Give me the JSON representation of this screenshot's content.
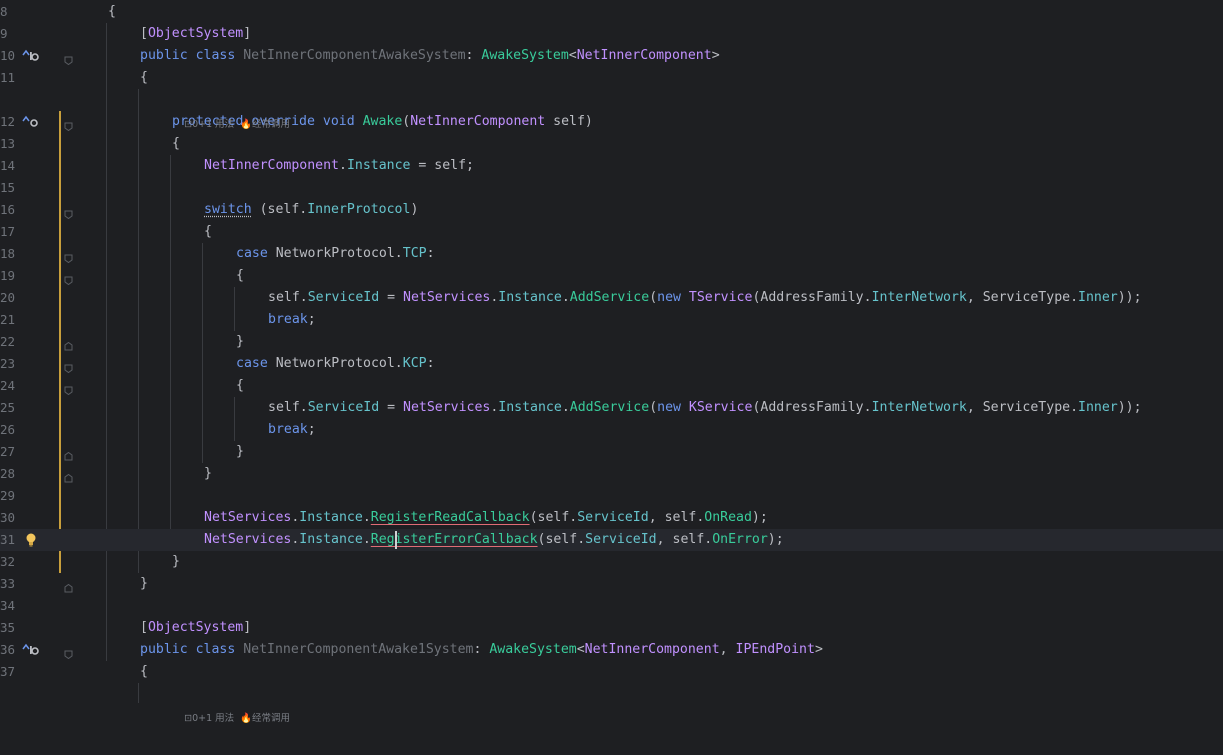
{
  "editor": {
    "colors": {
      "background": "#1e1f22",
      "keyword": "#6c95eb",
      "type": "#c191ff",
      "method": "#39cc9b",
      "field": "#66c3cc",
      "line_number": "#6f737a",
      "vcs_modified": "#c89f3c"
    },
    "hints": [
      {
        "line": 12,
        "usages": "0+1 用法",
        "frequent": "经常调用"
      },
      {
        "line": 38,
        "usages": "0+1 用法",
        "frequent": "经常调用"
      }
    ],
    "lines": [
      {
        "n": "8",
        "indent": 0,
        "fold": false,
        "gutter_icon": "",
        "tokens": [
          {
            "t": "{",
            "c": "pun"
          }
        ]
      },
      {
        "n": "9",
        "indent": 1,
        "fold": false,
        "gutter_icon": "",
        "tokens": [
          {
            "t": "[",
            "c": "pun"
          },
          {
            "t": "ObjectSystem",
            "c": "attr"
          },
          {
            "t": "]",
            "c": "pun"
          }
        ]
      },
      {
        "n": "10",
        "indent": 1,
        "fold": true,
        "gutter_icon": "implemented-icon",
        "tokens": [
          {
            "t": "public ",
            "c": "kw"
          },
          {
            "t": "class ",
            "c": "kw"
          },
          {
            "t": "NetInnerComponentAwakeSystem",
            "c": "tyd"
          },
          {
            "t": ": ",
            "c": "pun"
          },
          {
            "t": "AwakeSystem",
            "c": "mt"
          },
          {
            "t": "<",
            "c": "pun"
          },
          {
            "t": "NetInnerComponent",
            "c": "ty"
          },
          {
            "t": ">",
            "c": "pun"
          }
        ]
      },
      {
        "n": "11",
        "indent": 1,
        "fold": false,
        "gutter_icon": "",
        "tokens": [
          {
            "t": "{",
            "c": "pun"
          }
        ]
      },
      {
        "n": "12",
        "indent": 2,
        "fold": true,
        "gutter_icon": "override-icon",
        "tokens": [
          {
            "t": "protected ",
            "c": "kw"
          },
          {
            "t": "override ",
            "c": "kw"
          },
          {
            "t": "void ",
            "c": "kw"
          },
          {
            "t": "Awake",
            "c": "mt"
          },
          {
            "t": "(",
            "c": "pun"
          },
          {
            "t": "NetInnerComponent",
            "c": "ty"
          },
          {
            "t": " self)",
            "c": "tx"
          }
        ]
      },
      {
        "n": "13",
        "indent": 2,
        "fold": false,
        "gutter_icon": "",
        "tokens": [
          {
            "t": "{",
            "c": "pun"
          }
        ]
      },
      {
        "n": "14",
        "indent": 3,
        "fold": false,
        "gutter_icon": "",
        "tokens": [
          {
            "t": "NetInnerComponent",
            "c": "ty"
          },
          {
            "t": ".",
            "c": "pun"
          },
          {
            "t": "Instance",
            "c": "fd"
          },
          {
            "t": " = self;",
            "c": "tx"
          }
        ]
      },
      {
        "n": "15",
        "indent": 0,
        "fold": false,
        "gutter_icon": "",
        "tokens": []
      },
      {
        "n": "16",
        "indent": 3,
        "fold": true,
        "gutter_icon": "",
        "tokens": [
          {
            "t": "switch",
            "c": "kw ul-dot"
          },
          {
            "t": " (self.",
            "c": "tx"
          },
          {
            "t": "InnerProtocol",
            "c": "fd"
          },
          {
            "t": ")",
            "c": "pun"
          }
        ]
      },
      {
        "n": "17",
        "indent": 3,
        "fold": false,
        "gutter_icon": "",
        "tokens": [
          {
            "t": "{",
            "c": "pun"
          }
        ]
      },
      {
        "n": "18",
        "indent": 4,
        "fold": true,
        "gutter_icon": "",
        "tokens": [
          {
            "t": "case ",
            "c": "kw"
          },
          {
            "t": "NetworkProtocol",
            "c": "tx"
          },
          {
            "t": ".",
            "c": "pun"
          },
          {
            "t": "TCP",
            "c": "fd"
          },
          {
            "t": ":",
            "c": "pun"
          }
        ]
      },
      {
        "n": "19",
        "indent": 4,
        "fold": true,
        "gutter_icon": "",
        "tokens": [
          {
            "t": "{",
            "c": "pun"
          }
        ]
      },
      {
        "n": "20",
        "indent": 5,
        "fold": false,
        "gutter_icon": "",
        "tokens": [
          {
            "t": "self.",
            "c": "tx"
          },
          {
            "t": "ServiceId",
            "c": "fd"
          },
          {
            "t": " = ",
            "c": "tx"
          },
          {
            "t": "NetServices",
            "c": "ty"
          },
          {
            "t": ".",
            "c": "pun"
          },
          {
            "t": "Instance",
            "c": "fd"
          },
          {
            "t": ".",
            "c": "pun"
          },
          {
            "t": "AddService",
            "c": "mt"
          },
          {
            "t": "(",
            "c": "pun"
          },
          {
            "t": "new ",
            "c": "kw"
          },
          {
            "t": "TService",
            "c": "ty"
          },
          {
            "t": "(",
            "c": "pun"
          },
          {
            "t": "AddressFamily",
            "c": "tx"
          },
          {
            "t": ".",
            "c": "pun"
          },
          {
            "t": "InterNetwork",
            "c": "fd"
          },
          {
            "t": ", ",
            "c": "pun"
          },
          {
            "t": "ServiceType",
            "c": "tx"
          },
          {
            "t": ".",
            "c": "pun"
          },
          {
            "t": "Inner",
            "c": "fd"
          },
          {
            "t": "));",
            "c": "pun"
          }
        ]
      },
      {
        "n": "21",
        "indent": 5,
        "fold": false,
        "gutter_icon": "",
        "tokens": [
          {
            "t": "break",
            "c": "kw"
          },
          {
            "t": ";",
            "c": "pun"
          }
        ]
      },
      {
        "n": "22",
        "indent": 4,
        "fold": true,
        "gutter_icon": "",
        "tokens": [
          {
            "t": "}",
            "c": "pun"
          }
        ]
      },
      {
        "n": "23",
        "indent": 4,
        "fold": true,
        "gutter_icon": "",
        "tokens": [
          {
            "t": "case ",
            "c": "kw"
          },
          {
            "t": "NetworkProtocol",
            "c": "tx"
          },
          {
            "t": ".",
            "c": "pun"
          },
          {
            "t": "KCP",
            "c": "fd"
          },
          {
            "t": ":",
            "c": "pun"
          }
        ]
      },
      {
        "n": "24",
        "indent": 4,
        "fold": true,
        "gutter_icon": "",
        "tokens": [
          {
            "t": "{",
            "c": "pun"
          }
        ]
      },
      {
        "n": "25",
        "indent": 5,
        "fold": false,
        "gutter_icon": "",
        "tokens": [
          {
            "t": "self.",
            "c": "tx"
          },
          {
            "t": "ServiceId",
            "c": "fd"
          },
          {
            "t": " = ",
            "c": "tx"
          },
          {
            "t": "NetServices",
            "c": "ty"
          },
          {
            "t": ".",
            "c": "pun"
          },
          {
            "t": "Instance",
            "c": "fd"
          },
          {
            "t": ".",
            "c": "pun"
          },
          {
            "t": "AddService",
            "c": "mt"
          },
          {
            "t": "(",
            "c": "pun"
          },
          {
            "t": "new ",
            "c": "kw"
          },
          {
            "t": "KService",
            "c": "ty"
          },
          {
            "t": "(",
            "c": "pun"
          },
          {
            "t": "AddressFamily",
            "c": "tx"
          },
          {
            "t": ".",
            "c": "pun"
          },
          {
            "t": "InterNetwork",
            "c": "fd"
          },
          {
            "t": ", ",
            "c": "pun"
          },
          {
            "t": "ServiceType",
            "c": "tx"
          },
          {
            "t": ".",
            "c": "pun"
          },
          {
            "t": "Inner",
            "c": "fd"
          },
          {
            "t": "));",
            "c": "pun"
          }
        ]
      },
      {
        "n": "26",
        "indent": 5,
        "fold": false,
        "gutter_icon": "",
        "tokens": [
          {
            "t": "break",
            "c": "kw"
          },
          {
            "t": ";",
            "c": "pun"
          }
        ]
      },
      {
        "n": "27",
        "indent": 4,
        "fold": true,
        "gutter_icon": "",
        "tokens": [
          {
            "t": "}",
            "c": "pun"
          }
        ]
      },
      {
        "n": "28",
        "indent": 3,
        "fold": true,
        "gutter_icon": "",
        "tokens": [
          {
            "t": "}",
            "c": "pun"
          }
        ]
      },
      {
        "n": "29",
        "indent": 0,
        "fold": false,
        "gutter_icon": "",
        "tokens": []
      },
      {
        "n": "30",
        "indent": 3,
        "fold": false,
        "gutter_icon": "",
        "tokens": [
          {
            "t": "NetServices",
            "c": "ty"
          },
          {
            "t": ".",
            "c": "pun"
          },
          {
            "t": "Instance",
            "c": "fd"
          },
          {
            "t": ".",
            "c": "pun"
          },
          {
            "t": "RegisterReadCallback",
            "c": "mt ul-warn"
          },
          {
            "t": "(self.",
            "c": "tx"
          },
          {
            "t": "ServiceId",
            "c": "fd"
          },
          {
            "t": ", self.",
            "c": "tx"
          },
          {
            "t": "OnRead",
            "c": "mt"
          },
          {
            "t": ");",
            "c": "pun"
          }
        ]
      },
      {
        "n": "31",
        "indent": 3,
        "fold": false,
        "gutter_icon": "bulb-icon",
        "current": true,
        "tokens": [
          {
            "t": "NetServices",
            "c": "ty"
          },
          {
            "t": ".",
            "c": "pun"
          },
          {
            "t": "Instance",
            "c": "fd"
          },
          {
            "t": ".",
            "c": "pun"
          },
          {
            "t": "RegisterErrorCallback",
            "c": "mt ul-warn"
          },
          {
            "t": "(self.",
            "c": "tx"
          },
          {
            "t": "ServiceId",
            "c": "fd"
          },
          {
            "t": ", self.",
            "c": "tx"
          },
          {
            "t": "OnError",
            "c": "mt"
          },
          {
            "t": ");",
            "c": "pun"
          }
        ]
      },
      {
        "n": "32",
        "indent": 2,
        "fold": false,
        "gutter_icon": "",
        "tokens": [
          {
            "t": "}",
            "c": "pun"
          }
        ]
      },
      {
        "n": "33",
        "indent": 1,
        "fold": true,
        "gutter_icon": "",
        "tokens": [
          {
            "t": "}",
            "c": "pun"
          }
        ]
      },
      {
        "n": "34",
        "indent": 0,
        "fold": false,
        "gutter_icon": "",
        "tokens": []
      },
      {
        "n": "35",
        "indent": 1,
        "fold": false,
        "gutter_icon": "",
        "tokens": [
          {
            "t": "[",
            "c": "pun"
          },
          {
            "t": "ObjectSystem",
            "c": "attr"
          },
          {
            "t": "]",
            "c": "pun"
          }
        ]
      },
      {
        "n": "36",
        "indent": 1,
        "fold": true,
        "gutter_icon": "implemented-icon",
        "tokens": [
          {
            "t": "public ",
            "c": "kw"
          },
          {
            "t": "class ",
            "c": "kw"
          },
          {
            "t": "NetInnerComponentAwake1System",
            "c": "tyd"
          },
          {
            "t": ": ",
            "c": "pun"
          },
          {
            "t": "AwakeSystem",
            "c": "mt"
          },
          {
            "t": "<",
            "c": "pun"
          },
          {
            "t": "NetInnerComponent",
            "c": "ty"
          },
          {
            "t": ", ",
            "c": "pun"
          },
          {
            "t": "IPEndPoint",
            "c": "ty"
          },
          {
            "t": ">",
            "c": "pun"
          }
        ]
      },
      {
        "n": "37",
        "indent": 1,
        "fold": false,
        "gutter_icon": "",
        "tokens": [
          {
            "t": "{",
            "c": "pun"
          }
        ]
      }
    ]
  }
}
